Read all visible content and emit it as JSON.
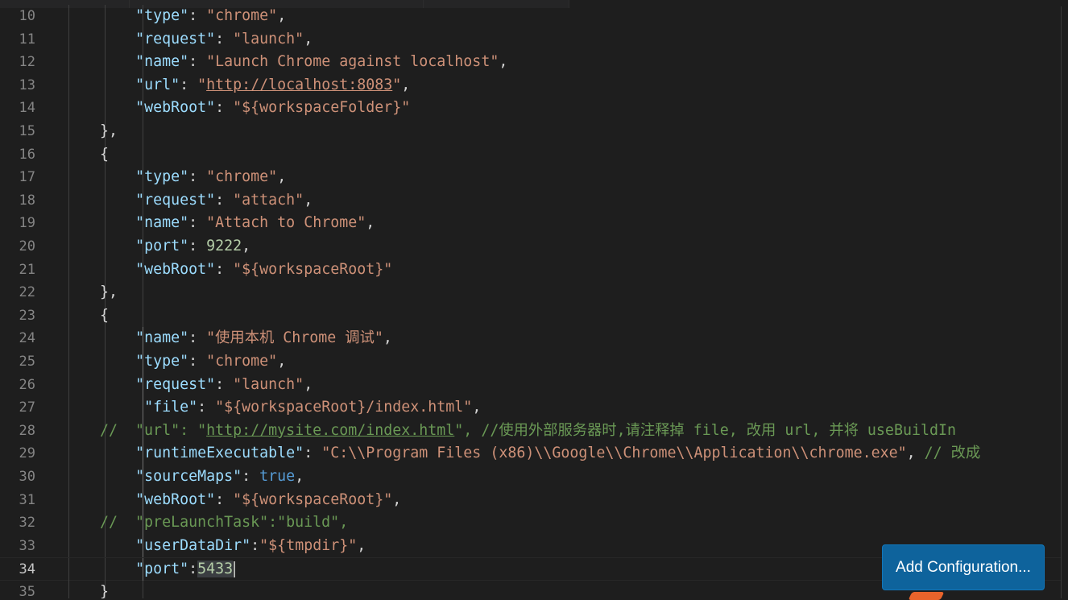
{
  "editor": {
    "language": "json",
    "lines": [
      {
        "num": "10",
        "current": false,
        "segments": [
          [
            "p",
            "        "
          ],
          [
            "k",
            "\"type\""
          ],
          [
            "p",
            ": "
          ],
          [
            "s",
            "\"chrome\""
          ],
          [
            "p",
            ","
          ]
        ]
      },
      {
        "num": "11",
        "current": false,
        "segments": [
          [
            "p",
            "        "
          ],
          [
            "k",
            "\"request\""
          ],
          [
            "p",
            ": "
          ],
          [
            "s",
            "\"launch\""
          ],
          [
            "p",
            ","
          ]
        ]
      },
      {
        "num": "12",
        "current": false,
        "segments": [
          [
            "p",
            "        "
          ],
          [
            "k",
            "\"name\""
          ],
          [
            "p",
            ": "
          ],
          [
            "s",
            "\"Launch Chrome against localhost\""
          ],
          [
            "p",
            ","
          ]
        ]
      },
      {
        "num": "13",
        "current": false,
        "segments": [
          [
            "p",
            "        "
          ],
          [
            "k",
            "\"url\""
          ],
          [
            "p",
            ": "
          ],
          [
            "s",
            "\""
          ],
          [
            "s uo",
            "http://localhost:8083"
          ],
          [
            "s",
            "\""
          ],
          [
            "p",
            ","
          ]
        ]
      },
      {
        "num": "14",
        "current": false,
        "segments": [
          [
            "p",
            "        "
          ],
          [
            "k",
            "\"webRoot\""
          ],
          [
            "p",
            ": "
          ],
          [
            "s",
            "\"${workspaceFolder}\""
          ]
        ]
      },
      {
        "num": "15",
        "current": false,
        "segments": [
          [
            "p",
            "    },"
          ]
        ]
      },
      {
        "num": "16",
        "current": false,
        "segments": [
          [
            "p",
            "    {"
          ]
        ]
      },
      {
        "num": "17",
        "current": false,
        "segments": [
          [
            "p",
            "        "
          ],
          [
            "k",
            "\"type\""
          ],
          [
            "p",
            ": "
          ],
          [
            "s",
            "\"chrome\""
          ],
          [
            "p",
            ","
          ]
        ]
      },
      {
        "num": "18",
        "current": false,
        "segments": [
          [
            "p",
            "        "
          ],
          [
            "k",
            "\"request\""
          ],
          [
            "p",
            ": "
          ],
          [
            "s",
            "\"attach\""
          ],
          [
            "p",
            ","
          ]
        ]
      },
      {
        "num": "19",
        "current": false,
        "segments": [
          [
            "p",
            "        "
          ],
          [
            "k",
            "\"name\""
          ],
          [
            "p",
            ": "
          ],
          [
            "s",
            "\"Attach to Chrome\""
          ],
          [
            "p",
            ","
          ]
        ]
      },
      {
        "num": "20",
        "current": false,
        "segments": [
          [
            "p",
            "        "
          ],
          [
            "k",
            "\"port\""
          ],
          [
            "p",
            ": "
          ],
          [
            "n",
            "9222"
          ],
          [
            "p",
            ","
          ]
        ]
      },
      {
        "num": "21",
        "current": false,
        "segments": [
          [
            "p",
            "        "
          ],
          [
            "k",
            "\"webRoot\""
          ],
          [
            "p",
            ": "
          ],
          [
            "s",
            "\"${workspaceRoot}\""
          ]
        ]
      },
      {
        "num": "22",
        "current": false,
        "segments": [
          [
            "p",
            "    },"
          ]
        ]
      },
      {
        "num": "23",
        "current": false,
        "segments": [
          [
            "p",
            "    {"
          ]
        ]
      },
      {
        "num": "24",
        "current": false,
        "segments": [
          [
            "p",
            "        "
          ],
          [
            "k",
            "\"name\""
          ],
          [
            "p",
            ": "
          ],
          [
            "s",
            "\"使用本机 Chrome 调试\""
          ],
          [
            "p",
            ","
          ]
        ]
      },
      {
        "num": "25",
        "current": false,
        "segments": [
          [
            "p",
            "        "
          ],
          [
            "k",
            "\"type\""
          ],
          [
            "p",
            ": "
          ],
          [
            "s",
            "\"chrome\""
          ],
          [
            "p",
            ","
          ]
        ]
      },
      {
        "num": "26",
        "current": false,
        "segments": [
          [
            "p",
            "        "
          ],
          [
            "k",
            "\"request\""
          ],
          [
            "p",
            ": "
          ],
          [
            "s",
            "\"launch\""
          ],
          [
            "p",
            ","
          ]
        ]
      },
      {
        "num": "27",
        "current": false,
        "segments": [
          [
            "p",
            "         "
          ],
          [
            "k",
            "\"file\""
          ],
          [
            "p",
            ": "
          ],
          [
            "s",
            "\"${workspaceRoot}/index.html\""
          ],
          [
            "p",
            ","
          ]
        ]
      },
      {
        "num": "28",
        "current": false,
        "segments": [
          [
            "c",
            "    //  \"url\": \""
          ],
          [
            "c u",
            "http://mysite.com/index.html"
          ],
          [
            "c",
            "\", //使用外部服务器时,请注释掉 file, 改用 url, 并将 useBuildIn"
          ]
        ]
      },
      {
        "num": "29",
        "current": false,
        "segments": [
          [
            "p",
            "        "
          ],
          [
            "k",
            "\"runtimeExecutable\""
          ],
          [
            "p",
            ": "
          ],
          [
            "s",
            "\"C:\\\\Program Files (x86)\\\\Google\\\\Chrome\\\\Application\\\\chrome.exe\""
          ],
          [
            "p",
            ", "
          ],
          [
            "c",
            "// 改成"
          ]
        ]
      },
      {
        "num": "30",
        "current": false,
        "segments": [
          [
            "p",
            "        "
          ],
          [
            "k",
            "\"sourceMaps\""
          ],
          [
            "p",
            ": "
          ],
          [
            "b",
            "true"
          ],
          [
            "p",
            ","
          ]
        ]
      },
      {
        "num": "31",
        "current": false,
        "segments": [
          [
            "p",
            "        "
          ],
          [
            "k",
            "\"webRoot\""
          ],
          [
            "p",
            ": "
          ],
          [
            "s",
            "\"${workspaceRoot}\""
          ],
          [
            "p",
            ","
          ]
        ]
      },
      {
        "num": "32",
        "current": false,
        "segments": [
          [
            "c",
            "    //  \"preLaunchTask\":\"build\","
          ]
        ]
      },
      {
        "num": "33",
        "current": false,
        "segments": [
          [
            "p",
            "        "
          ],
          [
            "k",
            "\"userDataDir\""
          ],
          [
            "p",
            ":"
          ],
          [
            "s",
            "\"${tmpdir}\""
          ],
          [
            "p",
            ","
          ]
        ]
      },
      {
        "num": "34",
        "current": true,
        "segments": [
          [
            "p",
            "        "
          ],
          [
            "k",
            "\"port\""
          ],
          [
            "p",
            ":"
          ],
          [
            "n sel",
            "5433"
          ]
        ]
      },
      {
        "num": "35",
        "current": false,
        "segments": [
          [
            "p",
            "    }"
          ]
        ]
      }
    ]
  },
  "add_configuration_button": {
    "label": "Add Configuration..."
  },
  "colors": {
    "background": "#1e1e1e",
    "key": "#9cdcfe",
    "string": "#ce9178",
    "number": "#b5cea8",
    "boolean": "#569cd6",
    "comment": "#6a9955",
    "button": "#0e639c"
  }
}
